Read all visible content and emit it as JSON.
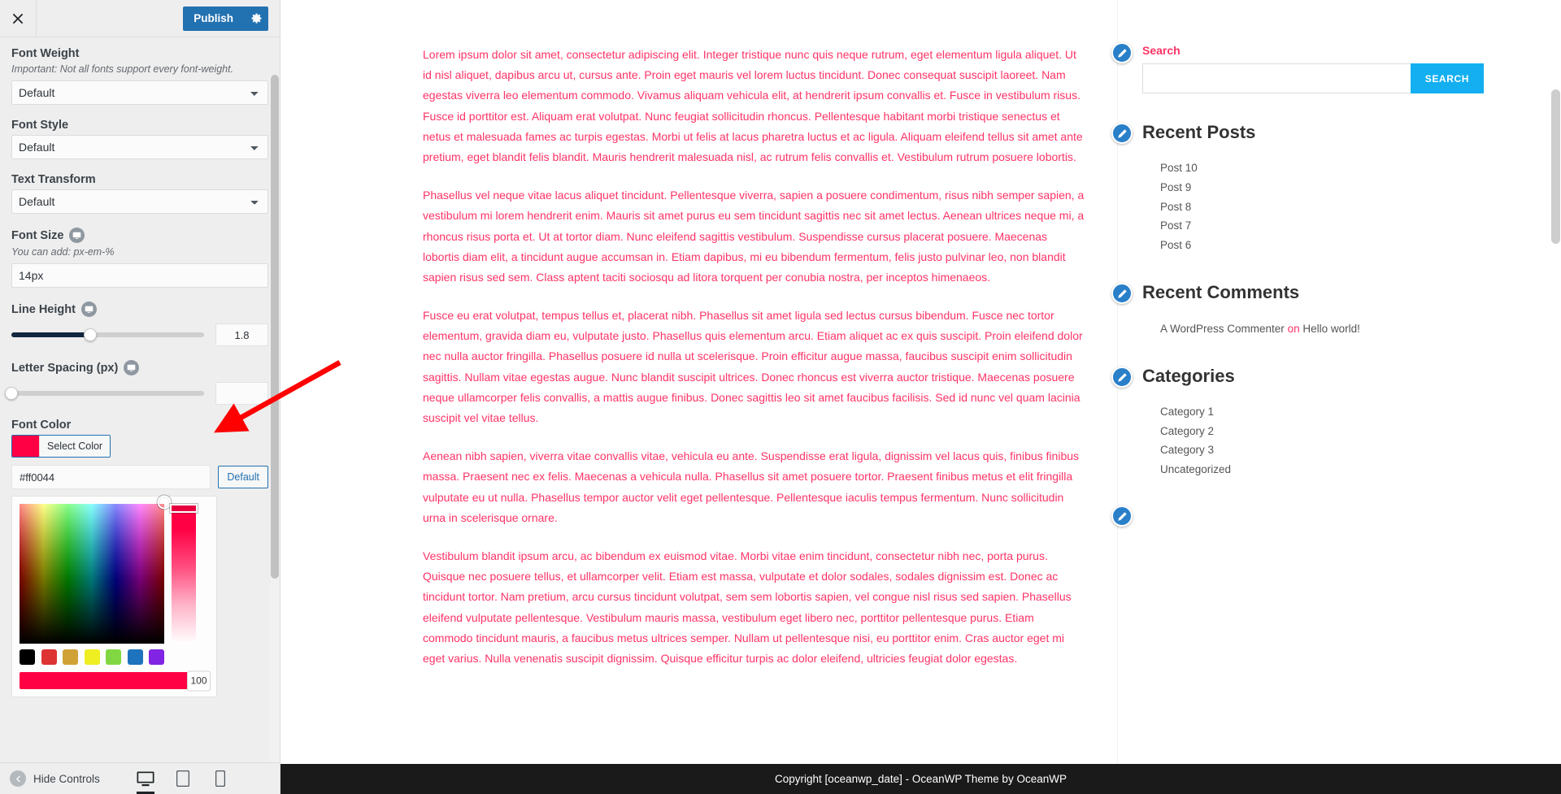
{
  "customizer": {
    "close_label": "Close",
    "publish_label": "Publish",
    "gear_label": "Publish settings",
    "hide_controls_label": "Hide Controls",
    "devices": [
      {
        "name": "desktop",
        "label": "Desktop",
        "active": true
      },
      {
        "name": "tablet",
        "label": "Tablet",
        "active": false
      },
      {
        "name": "mobile",
        "label": "Mobile",
        "active": false
      }
    ],
    "controls": {
      "font_weight": {
        "label": "Font Weight",
        "description": "Important: Not all fonts support every font-weight.",
        "value": "Default",
        "options": [
          "Default"
        ]
      },
      "font_style": {
        "label": "Font Style",
        "value": "Default",
        "options": [
          "Default"
        ]
      },
      "text_transform": {
        "label": "Text Transform",
        "value": "Default",
        "options": [
          "Default"
        ]
      },
      "font_size": {
        "label": "Font Size",
        "description": "You can add: px-em-%",
        "value": "14px",
        "placeholder": ""
      },
      "line_height": {
        "label": "Line Height",
        "value": "1.8",
        "slider_percent": 41
      },
      "letter_spacing": {
        "label": "Letter Spacing (px)",
        "value": "",
        "slider_percent": 0
      },
      "font_color": {
        "label": "Font Color",
        "select_color_label": "Select Color",
        "hex_value": "#ff0044",
        "default_label": "Default",
        "alpha_value": "100",
        "swatches": [
          "#000000",
          "#dd3333",
          "#d0a236",
          "#eeee22",
          "#81d742",
          "#1e73be",
          "#8224e3"
        ]
      }
    }
  },
  "preview": {
    "paragraphs": [
      "Lorem ipsum dolor sit amet, consectetur adipiscing elit. Integer tristique nunc quis neque rutrum, eget elementum ligula aliquet. Ut id nisl aliquet, dapibus arcu ut, cursus ante. Proin eget mauris vel lorem luctus tincidunt. Donec consequat suscipit laoreet. Nam egestas viverra leo elementum commodo. Vivamus aliquam vehicula elit, at hendrerit ipsum convallis et. Fusce in vestibulum risus. Fusce id porttitor est. Aliquam erat volutpat. Nunc feugiat sollicitudin rhoncus. Pellentesque habitant morbi tristique senectus et netus et malesuada fames ac turpis egestas. Morbi ut felis at lacus pharetra luctus et ac ligula. Aliquam eleifend tellus sit amet ante pretium, eget blandit felis blandit. Mauris hendrerit malesuada nisl, ac rutrum felis convallis et. Vestibulum rutrum posuere lobortis.",
      "Phasellus vel neque vitae lacus aliquet tincidunt. Pellentesque viverra, sapien a posuere condimentum, risus nibh semper sapien, a vestibulum mi lorem hendrerit enim. Mauris sit amet purus eu sem tincidunt sagittis nec sit amet lectus. Aenean ultrices neque mi, a rhoncus risus porta et. Ut at tortor diam. Nunc eleifend sagittis vestibulum. Suspendisse cursus placerat posuere. Maecenas lobortis diam elit, a tincidunt augue accumsan in. Etiam dapibus, mi eu bibendum fermentum, felis justo pulvinar leo, non blandit sapien risus sed sem. Class aptent taciti sociosqu ad litora torquent per conubia nostra, per inceptos himenaeos.",
      "Fusce eu erat volutpat, tempus tellus et, placerat nibh. Phasellus sit amet ligula sed lectus cursus bibendum. Fusce nec tortor elementum, gravida diam eu, vulputate justo. Phasellus quis elementum arcu. Etiam aliquet ac ex quis suscipit. Proin eleifend dolor nec nulla auctor fringilla. Phasellus posuere id nulla ut scelerisque. Proin efficitur augue massa, faucibus suscipit enim sollicitudin sagittis. Nullam vitae egestas augue. Nunc blandit suscipit ultrices. Donec rhoncus est viverra auctor tristique. Maecenas posuere neque ullamcorper felis convallis, a mattis augue finibus. Donec sagittis leo sit amet faucibus facilisis. Sed id nunc vel quam lacinia suscipit vel vitae tellus.",
      "Aenean nibh sapien, viverra vitae convallis vitae, vehicula eu ante. Suspendisse erat ligula, dignissim vel lacus quis, finibus finibus massa. Praesent nec ex felis. Maecenas a vehicula nulla. Phasellus sit amet posuere tortor. Praesent finibus metus et elit fringilla vulputate eu ut nulla. Phasellus tempor auctor velit eget pellentesque. Pellentesque iaculis tempus fermentum. Nunc sollicitudin urna in scelerisque ornare.",
      "Vestibulum blandit ipsum arcu, ac bibendum ex euismod vitae. Morbi vitae enim tincidunt, consectetur nibh nec, porta purus. Quisque nec posuere tellus, et ullamcorper velit. Etiam est massa, vulputate et dolor sodales, sodales dignissim est. Donec ac tincidunt tortor. Nam pretium, arcu cursus tincidunt volutpat, sem sem lobortis sapien, vel congue nisl risus sed sapien. Phasellus eleifend vulputate pellentesque. Vestibulum mauris massa, vestibulum eget libero nec, porttitor pellentesque purus. Etiam commodo tincidunt mauris, a faucibus metus ultrices semper. Nullam ut pellentesque nisi, eu porttitor enim. Cras auctor eget mi eget varius. Nulla venenatis suscipit dignissim. Quisque efficitur turpis ac dolor eleifend, ultricies feugiat dolor egestas."
    ],
    "widgets": {
      "search": {
        "title": "Search",
        "input_value": "",
        "input_placeholder": "",
        "button_label": "SEARCH"
      },
      "recent_posts": {
        "title": "Recent Posts",
        "items": [
          "Post 10",
          "Post 9",
          "Post 8",
          "Post 7",
          "Post 6"
        ]
      },
      "recent_comments": {
        "title": "Recent Comments",
        "author": "A WordPress Commenter",
        "on": "on",
        "post": "Hello world!"
      },
      "categories": {
        "title": "Categories",
        "items": [
          "Category 1",
          "Category 2",
          "Category 3",
          "Uncategorized"
        ]
      }
    },
    "footer_text": "Copyright [oceanwp_date] - OceanWP Theme by OceanWP"
  },
  "theme_colors": {
    "accent_blue": "#2271b1",
    "link_blue": "#13aff0",
    "font_color_pink": "#ff3366",
    "slider_fill": "#12263f",
    "annotation_arrow": "#ff0000"
  }
}
